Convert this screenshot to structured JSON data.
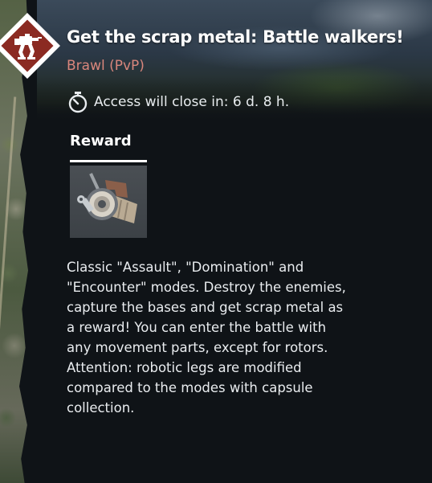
{
  "event": {
    "title": "Get the scrap metal: Battle walkers!",
    "mode": "Brawl (PvP)",
    "access_text": "Access will close in: 6 d. 8 h.",
    "icons": {
      "badge": "walker-mech-icon",
      "timer": "stopwatch-icon",
      "reward": "scrap-metal-icon"
    },
    "colors": {
      "title": "#ffffff",
      "mode": "#d9867c",
      "badge_bg": "#8b2a22",
      "panel_bg": "#0f1317"
    }
  },
  "reward": {
    "tab_label": "Reward"
  },
  "description": {
    "lines": [
      "Classic \"Assault\", \"Domination\" and",
      "\"Encounter\" modes. Destroy the enemies,",
      "capture the bases and get scrap metal as",
      "a reward! You can enter the battle with",
      "any movement parts, except for rotors.",
      "Attention: robotic legs are modified",
      "compared to the modes with capsule",
      "collection."
    ]
  }
}
